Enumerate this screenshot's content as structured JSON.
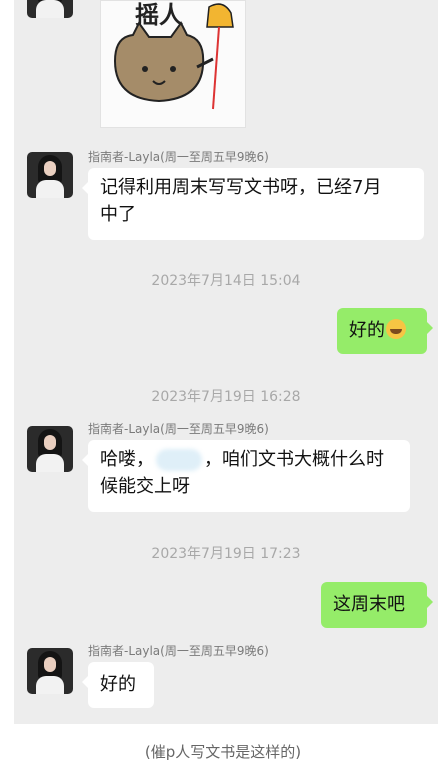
{
  "sender_name": "指南者-Layla(周一至周五早9晚6)",
  "sticker_text": "摇人",
  "messages": [
    {
      "text_line1": "记得利用周末写写文书呀，已经7月",
      "text_line2": "中了"
    },
    {
      "timestamp": "2023年7月14日 15:04"
    },
    {
      "text": "好的"
    },
    {
      "timestamp": "2023年7月19日 16:28"
    },
    {
      "text_before": "哈喽，",
      "text_after": "，咱们文书大概什么时",
      "text_line2": "候能交上呀"
    },
    {
      "timestamp": "2023年7月19日 17:23"
    },
    {
      "text": "这周末吧"
    },
    {
      "text": "好的"
    }
  ],
  "caption": "(催p人写文书是这样的)",
  "colors": {
    "chat_bg": "#ededed",
    "self_bubble": "#95ec69",
    "other_bubble": "#ffffff"
  }
}
